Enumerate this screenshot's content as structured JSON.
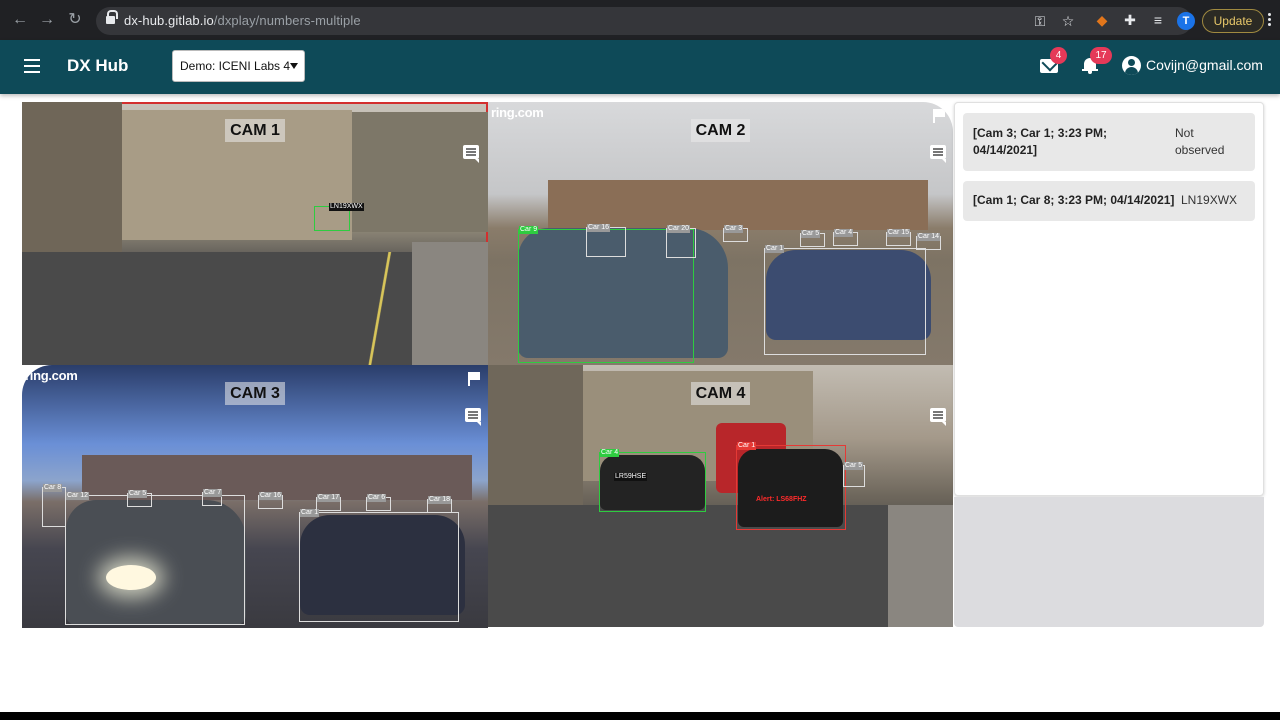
{
  "browser": {
    "url_host": "dx-hub.gitlab.io",
    "url_path": "/dxplay/numbers-multiple",
    "profile_initial": "T",
    "update_label": "Update"
  },
  "app": {
    "brand": "DX Hub",
    "demo_select": "Demo: ICENI Labs 4",
    "mail_count": "4",
    "notification_count": "17",
    "account_email": "Covijn@gmail.com"
  },
  "cameras": [
    {
      "label": "CAM 1",
      "active": true
    },
    {
      "label": "CAM 2",
      "active": false
    },
    {
      "label": "CAM 3",
      "active": false
    },
    {
      "label": "CAM 4",
      "active": false
    }
  ],
  "overlays": {
    "ring_logo": "ring.com",
    "cam1_plate": "LN19XWX",
    "cam2_boxes": [
      "Car 9",
      "Car 16",
      "Car 20",
      "Car 3",
      "Car 1",
      "Car 5",
      "Car 4",
      "Car 15",
      "Car 14"
    ],
    "cam3_boxes": [
      "Car 8",
      "Car 12",
      "Car 5",
      "Car 7",
      "Car 16",
      "Car 17",
      "Car 6",
      "Car 18",
      "Car 1"
    ],
    "cam4_boxes": [
      "Car 4",
      "LR59HSE",
      "Car 1",
      "Alert: LS68FHZ",
      "Car 5"
    ]
  },
  "events": [
    {
      "title": "[Cam 3; Car 1; 3:23 PM; 04/14/2021]",
      "status": "Not observed"
    },
    {
      "title": "[Cam 1; Car 8; 3:23 PM; 04/14/2021]",
      "status": "LN19XWX"
    }
  ],
  "colors": {
    "appbar": "#0e4a58",
    "badge": "#e53958",
    "active_cam_border": "#d32f2f"
  }
}
